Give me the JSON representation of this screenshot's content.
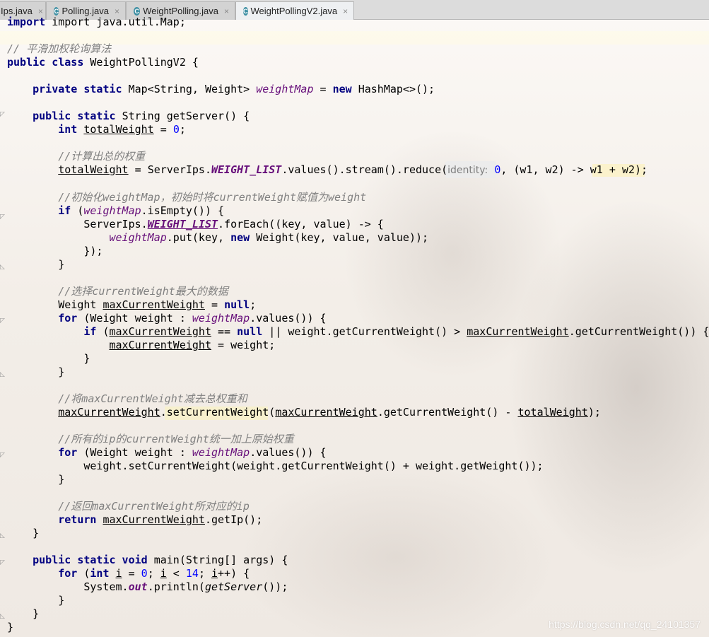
{
  "tabs": [
    {
      "label": "Ips.java",
      "close": "×"
    },
    {
      "label": "Polling.java",
      "close": "×",
      "icon": "C"
    },
    {
      "label": "WeightPolling.java",
      "close": "×",
      "icon": "C"
    },
    {
      "label": "WeightPollingV2.java",
      "close": "×",
      "icon": "C",
      "active": true
    }
  ],
  "code": {
    "l1": "import java.util.Map;",
    "c_class": "// 平滑加权轮询算法",
    "t_class": "WeightPollingV2",
    "t_map": "Map<String, Weight>",
    "f_weightMap": "weightMap",
    "t_hashmap": "HashMap<>();",
    "t_getserver": "String getServer() {",
    "v_total": "totalWeight",
    "n0": "0",
    "c_calc": "//计算出总的权重",
    "t_serverips": "ServerIps.",
    "sf_weightlist": "WEIGHT_LIST",
    "t_reduce": ".values().stream().reduce(",
    "hint_identity": "identity:",
    "t_lambda": ", (w1, w2) -> ",
    "t_w1w2": "w1 + w2",
    "t_end": ");",
    "c_init": "//初始化weightMap，初始时将currentWeight赋值为weight",
    "t_isempty": ".isEmpty()) {",
    "t_foreach": ".forEach((key, value) -> {",
    "t_put": ".put(key, ",
    "t_newweight": "Weight(key, value, value));",
    "t_close_lambda": "});",
    "c_select": "//选择currentWeight最大的数据",
    "t_weight": "Weight ",
    "v_max": "maxCurrentWeight",
    "t_nullsemi": ";",
    "t_for1": " (Weight weight : ",
    "t_values": ".values()) {",
    "t_eqnull": " == ",
    "t_or": " || weight.getCurrentWeight() > ",
    "t_getcw": ".getCurrentWeight()) {",
    "t_assign_weight": " = weight;",
    "c_sub": "//将maxCurrentWeight减去总权重和",
    "t_setcw": "setCurrentWeight",
    "t_getcw2": ".getCurrentWeight() - ",
    "c_all": "//所有的ip的currentWeight统一加上原始权重",
    "t_setcw_line": "weight.setCurrentWeight(weight.getCurrentWeight() + weight.getWeight());",
    "c_return": "//返回maxCurrentWeight所对应的ip",
    "t_getip": ".getIp();",
    "t_main": "main(String[] args) {",
    "v_i": "i",
    "n14": "14",
    "t_sysout": "System.",
    "sf_out": "out",
    "t_println": ".println(",
    "t_getserver_call": "getServer",
    "t_println_end": "());"
  },
  "watermark": "https://blog.csdn.net/qq_24101357"
}
